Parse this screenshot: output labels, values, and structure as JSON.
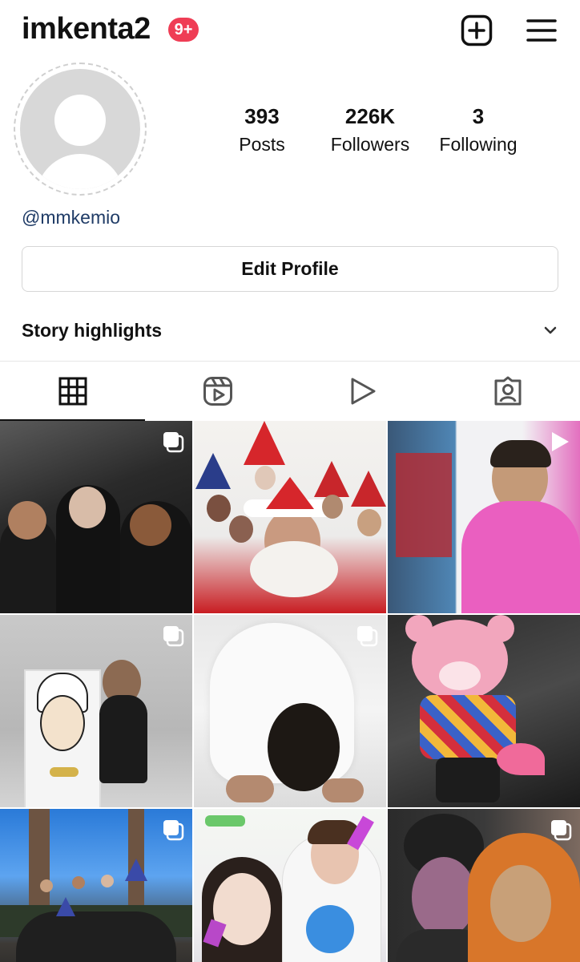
{
  "header": {
    "username": "imkenta2",
    "notification_badge": "9+",
    "new_post_icon": "plus-square-icon",
    "menu_icon": "hamburger-menu-icon"
  },
  "profile": {
    "avatar_icon": "default-avatar-icon",
    "handle": "@mmkemio",
    "stats": {
      "posts": {
        "value": "393",
        "label": "Posts"
      },
      "followers": {
        "value": "226K",
        "label": "Followers"
      },
      "following": {
        "value": "3",
        "label": "Following"
      }
    },
    "edit_profile_label": "Edit Profile"
  },
  "highlights": {
    "title": "Story highlights",
    "toggle_icon": "chevron-down-icon"
  },
  "tabs": [
    {
      "name": "posts-grid",
      "icon": "grid-icon",
      "active": true
    },
    {
      "name": "reels",
      "icon": "reels-icon",
      "active": false
    },
    {
      "name": "videos",
      "icon": "play-icon",
      "active": false
    },
    {
      "name": "tagged",
      "icon": "tagged-user-icon",
      "active": false
    }
  ],
  "grid": [
    {
      "type": "carousel",
      "desc": "group photo at night"
    },
    {
      "type": "single",
      "desc": "santa filter collage"
    },
    {
      "type": "reel",
      "desc": "person in pink sweater at laptop"
    },
    {
      "type": "carousel",
      "desc": "studio shoot with portrait board"
    },
    {
      "type": "carousel",
      "desc": "person on floor in white shirt"
    },
    {
      "type": "single",
      "desc": "pink bear plush"
    },
    {
      "type": "carousel",
      "desc": "group photo outdoors"
    },
    {
      "type": "single",
      "desc": "photo booth sticker"
    },
    {
      "type": "carousel",
      "desc": "costume makeup"
    }
  ]
}
